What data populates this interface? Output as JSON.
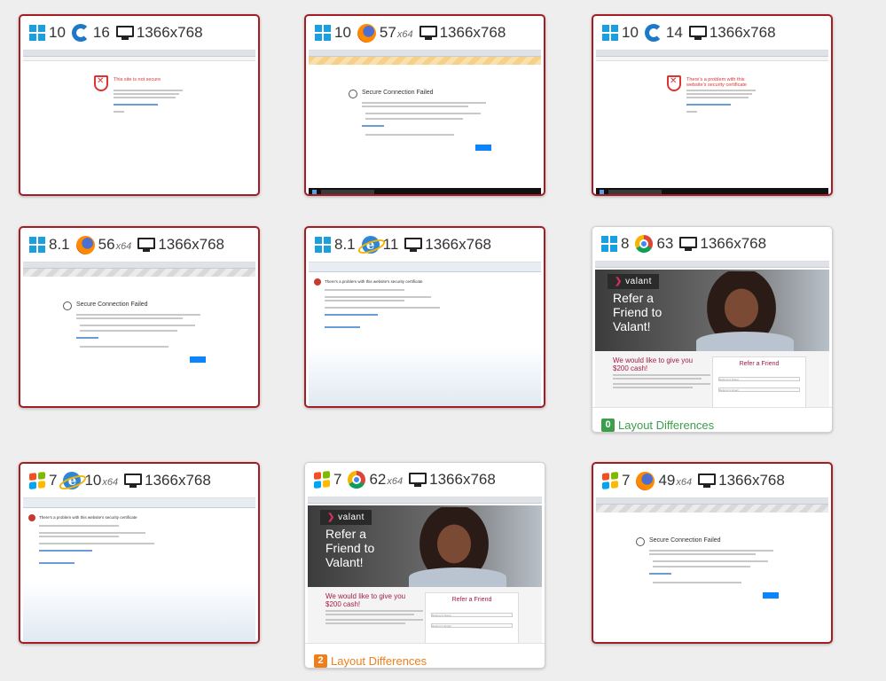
{
  "colors": {
    "fail_border": "#a31d24",
    "win_blue": "#1aa0e0",
    "diff_green": "#3d9e4a",
    "diff_orange": "#ee7f1a",
    "valant_red": "#a31d45"
  },
  "cards": [
    {
      "os_version": "10",
      "os_icon": "windows-10-icon",
      "browser_icon": "edge-icon",
      "browser_version": "16",
      "arch": "",
      "resolution": "1366x768",
      "status": "fail",
      "page": {
        "type": "edge",
        "title": "This site is not secure"
      }
    },
    {
      "os_version": "10",
      "os_icon": "windows-10-icon",
      "browser_icon": "firefox-icon",
      "browser_version": "57",
      "arch": "x64",
      "resolution": "1366x768",
      "status": "fail",
      "page": {
        "type": "firefox",
        "title": "Secure Connection Failed"
      }
    },
    {
      "os_version": "10",
      "os_icon": "windows-10-icon",
      "browser_icon": "edge-icon",
      "browser_version": "14",
      "arch": "",
      "resolution": "1366x768",
      "status": "fail",
      "page": {
        "type": "edge",
        "title": "There's a problem with this website's security certificate"
      }
    },
    {
      "os_version": "8.1",
      "os_icon": "windows-8-icon",
      "browser_icon": "firefox-icon",
      "browser_version": "56",
      "arch": "x64",
      "resolution": "1366x768",
      "status": "fail",
      "page": {
        "type": "firefox",
        "title": "Secure Connection Failed"
      }
    },
    {
      "os_version": "8.1",
      "os_icon": "windows-8-icon",
      "browser_icon": "ie-icon",
      "browser_version": "11",
      "arch": "",
      "resolution": "1366x768",
      "status": "fail",
      "page": {
        "type": "ie",
        "title": "There's a problem with this website's security certificate"
      }
    },
    {
      "os_version": "8",
      "os_icon": "windows-8-icon",
      "browser_icon": "chrome-icon",
      "browser_version": "63",
      "arch": "",
      "resolution": "1366x768",
      "status": "ok",
      "page": {
        "type": "valant",
        "logo": "valant",
        "headline": "Refer a Friend to Valant!",
        "cash": "We would like to give you $200 cash!",
        "form_title": "Refer a Friend",
        "field1": "Referrer's Name",
        "field2": "Referrer's Email"
      },
      "diff_count": "0",
      "diff_label": "Layout Differences",
      "diff_color": "green"
    },
    {
      "os_version": "7",
      "os_icon": "windows-7-icon",
      "browser_icon": "ie-icon",
      "browser_version": "10",
      "arch": "x64",
      "resolution": "1366x768",
      "status": "fail",
      "page": {
        "type": "ie",
        "title": "There's a problem with this website's security certificate"
      }
    },
    {
      "os_version": "7",
      "os_icon": "windows-7-icon",
      "browser_icon": "chrome-icon",
      "browser_version": "62",
      "arch": "x64",
      "resolution": "1366x768",
      "status": "ok",
      "page": {
        "type": "valant",
        "logo": "valant",
        "headline": "Refer a Friend to Valant!",
        "cash": "We would like to give you $200 cash!",
        "form_title": "Refer a Friend",
        "field1": "Referrer's Name",
        "field2": "Referrer's Email"
      },
      "diff_count": "2",
      "diff_label": "Layout Differences",
      "diff_color": "orange"
    },
    {
      "os_version": "7",
      "os_icon": "windows-7-icon",
      "browser_icon": "firefox-icon",
      "browser_version": "49",
      "arch": "x64",
      "resolution": "1366x768",
      "status": "fail",
      "page": {
        "type": "firefox",
        "title": "Secure Connection Failed"
      }
    }
  ]
}
